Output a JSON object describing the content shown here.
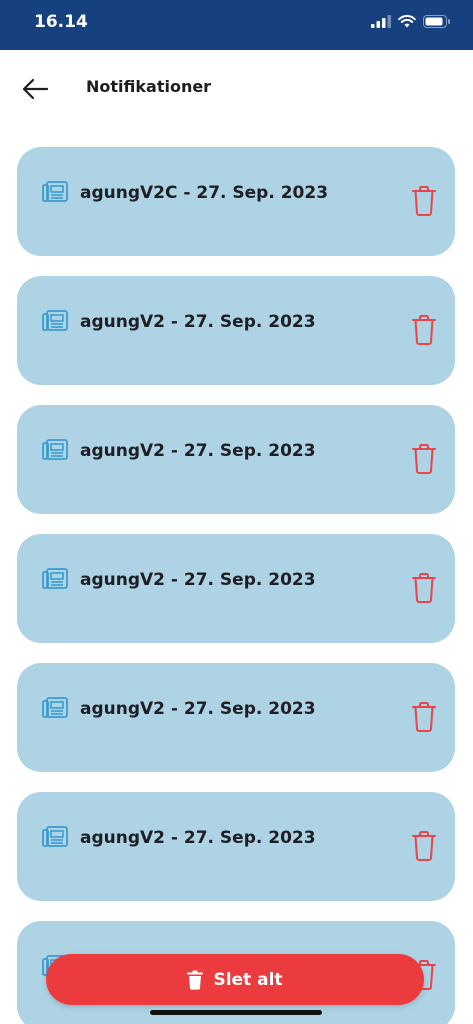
{
  "status_bar": {
    "time": "16.14"
  },
  "header": {
    "title": "Notifikationer"
  },
  "notifications": [
    {
      "text": "agungV2C - 27. Sep. 2023"
    },
    {
      "text": "agungV2 - 27. Sep. 2023"
    },
    {
      "text": "agungV2 - 27. Sep. 2023"
    },
    {
      "text": "agungV2 - 27. Sep. 2023"
    },
    {
      "text": "agungV2 - 27. Sep. 2023"
    },
    {
      "text": "agungV2 - 27. Sep. 2023"
    },
    {
      "text": ""
    }
  ],
  "actions": {
    "delete_all_label": "Slet alt"
  },
  "icons": {
    "back": "arrow-left-icon",
    "notification": "newspaper-icon",
    "delete": "trash-icon"
  },
  "colors": {
    "status_bar": "#17417e",
    "card": "#add3e4",
    "icon": "#3b9ccf",
    "delete": "#e8454a",
    "delete_all_button": "#ec3b3f"
  }
}
